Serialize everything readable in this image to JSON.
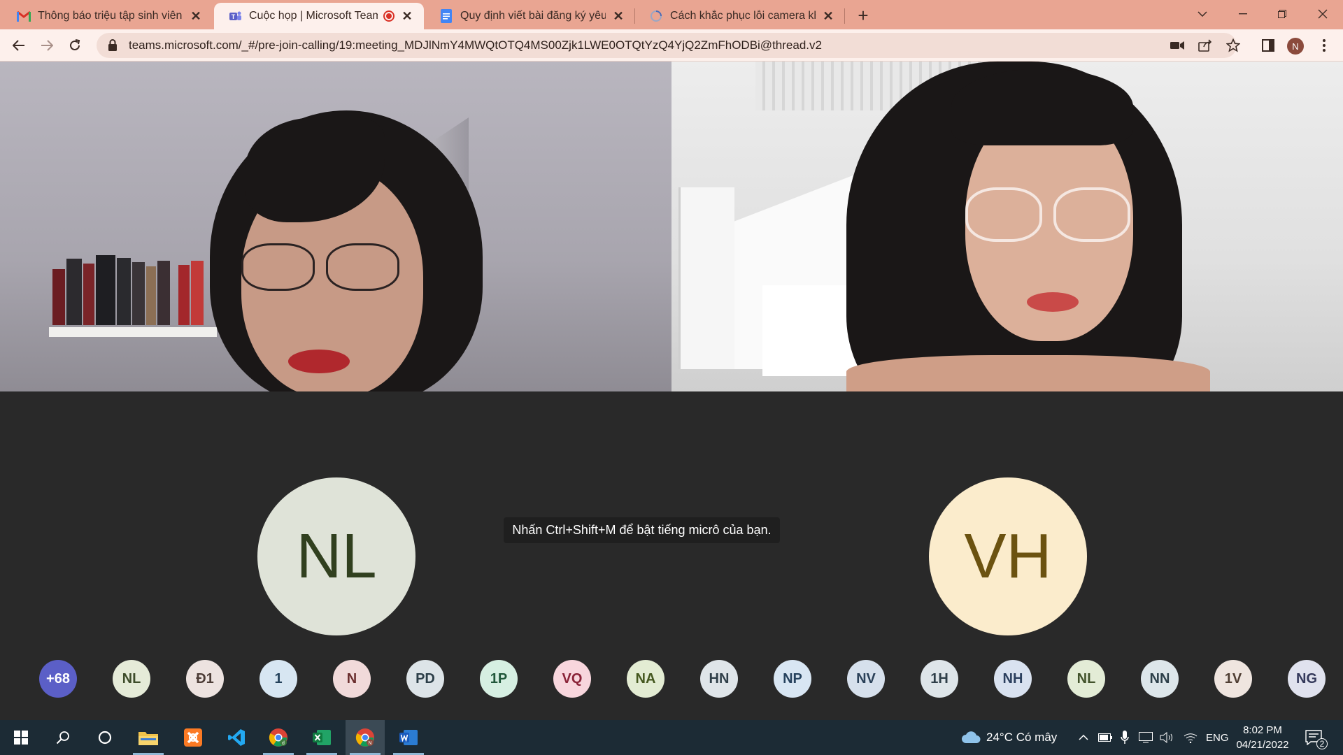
{
  "browser": {
    "tabs": [
      {
        "title": "Thông báo triệu tập sinh viên tha",
        "favicon": "gmail-icon"
      },
      {
        "title": "Cuộc họp | Microsoft Teams",
        "favicon": "teams-icon",
        "active": true,
        "recording": true
      },
      {
        "title": "Quy định viết bài đăng ký yêu dá",
        "favicon": "docs-icon"
      },
      {
        "title": "Cách khắc phục lỗi camera khôn",
        "favicon": "loading-icon"
      }
    ],
    "url": "teams.microsoft.com/_#/pre-join-calling/19:meeting_MDJlNmY4MWQtOTQ4MS00Zjk1LWE0OTQtYzQ4YjQ2ZmFhODBi@thread.v2",
    "profile_initial": "N"
  },
  "meeting": {
    "tooltip": "Nhấn Ctrl+Shift+M để bật tiếng micrô của bạn.",
    "featured": [
      {
        "initials": "NL",
        "bg": "#dfe3d8",
        "fg": "#31401f"
      },
      {
        "initials": "VH",
        "bg": "#fbeccc",
        "fg": "#6b5210"
      }
    ],
    "roster": [
      {
        "initials": "+68",
        "bg": "#5b5fc7",
        "fg": "#ffffff"
      },
      {
        "initials": "NL",
        "bg": "#e5ebd8",
        "fg": "#3e4d2b"
      },
      {
        "initials": "Đ1",
        "bg": "#ede3e0",
        "fg": "#4d3d37"
      },
      {
        "initials": "1",
        "bg": "#d7e6f2",
        "fg": "#23415a"
      },
      {
        "initials": "N",
        "bg": "#f1dada",
        "fg": "#6a2d2d"
      },
      {
        "initials": "PD",
        "bg": "#dde4e8",
        "fg": "#2c3e48"
      },
      {
        "initials": "1P",
        "bg": "#d6efe2",
        "fg": "#20573a"
      },
      {
        "initials": "VQ",
        "bg": "#f8d6dd",
        "fg": "#8a2338"
      },
      {
        "initials": "NA",
        "bg": "#e3ecd3",
        "fg": "#45581f"
      },
      {
        "initials": "HN",
        "bg": "#dfe5e9",
        "fg": "#2f3f49"
      },
      {
        "initials": "NP",
        "bg": "#d8e6f3",
        "fg": "#26425e"
      },
      {
        "initials": "NV",
        "bg": "#d6e0ec",
        "fg": "#2a4058"
      },
      {
        "initials": "1H",
        "bg": "#dee5e9",
        "fg": "#2f3f49"
      },
      {
        "initials": "NH",
        "bg": "#d9e2f0",
        "fg": "#2b3f5e"
      },
      {
        "initials": "NL",
        "bg": "#e3ecd6",
        "fg": "#41522a"
      },
      {
        "initials": "NN",
        "bg": "#dde6ea",
        "fg": "#2d404a"
      },
      {
        "initials": "1V",
        "bg": "#efe5df",
        "fg": "#4f3e33"
      },
      {
        "initials": "NG",
        "bg": "#e0e2ee",
        "fg": "#33385a"
      }
    ]
  },
  "taskbar": {
    "weather": "24°C  Có mây",
    "language": "ENG",
    "time": "8:02 PM",
    "date": "04/21/2022",
    "notifications": "2"
  }
}
